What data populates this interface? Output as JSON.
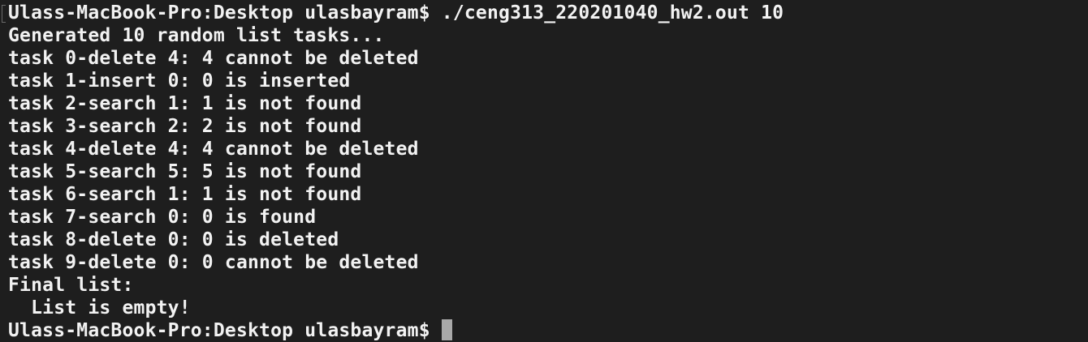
{
  "terminal": {
    "command_line": "Ulass-MacBook-Pro:Desktop ulasbayram$ ./ceng313_220201040_hw2.out 10",
    "output": [
      "Generated 10 random list tasks...",
      "task 0-delete 4: 4 cannot be deleted",
      "task 1-insert 0: 0 is inserted",
      "task 2-search 1: 1 is not found",
      "task 3-search 2: 2 is not found",
      "task 4-delete 4: 4 cannot be deleted",
      "task 5-search 5: 5 is not found",
      "task 6-search 1: 1 is not found",
      "task 7-search 0: 0 is found",
      "task 8-delete 0: 0 is deleted",
      "task 9-delete 0: 0 cannot be deleted",
      "Final list:",
      "  List is empty!"
    ],
    "prompt": "Ulass-MacBook-Pro:Desktop ulasbayram$ "
  },
  "colors": {
    "background": "#1e1e1e",
    "text": "#f2f2f2",
    "cursor": "#a9a9a9"
  }
}
